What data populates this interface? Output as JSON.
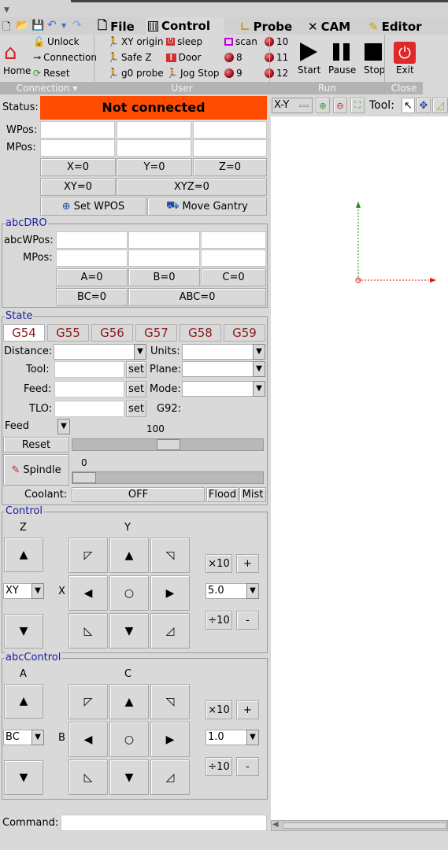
{
  "tabs": [
    {
      "label": "File",
      "icon": "file-icon"
    },
    {
      "label": "Control",
      "icon": "control-icon",
      "active": true
    },
    {
      "label": "Probe",
      "icon": "probe-icon"
    },
    {
      "label": "CAM",
      "icon": "cam-icon"
    },
    {
      "label": "Editor",
      "icon": "editor-icon"
    }
  ],
  "ribbon": {
    "connection": {
      "home": "Home",
      "unlock": "Unlock",
      "connection": "Connection",
      "reset": "Reset",
      "group": "Connection ▾"
    },
    "user": {
      "xy_origin": "XY origin",
      "safe_z": "Safe Z",
      "g0_probe": "g0 probe",
      "sleep": "sleep",
      "door": "Door",
      "jog_stop": "Jog Stop",
      "scan": "scan",
      "b8": "8",
      "b9": "9",
      "b10": "10",
      "b11": "11",
      "b12": "12",
      "group": "User"
    },
    "run": {
      "start": "Start",
      "pause": "Pause",
      "stop": "Stop",
      "group": "Run"
    },
    "close": {
      "exit": "Exit",
      "group": "Close"
    }
  },
  "status": {
    "label": "Status:",
    "value": "Not connected",
    "color": "#ff4c00"
  },
  "dro": {
    "wpos": "WPos:",
    "mpos": "MPos:",
    "x0": "X=0",
    "y0": "Y=0",
    "z0": "Z=0",
    "xy0": "XY=0",
    "xyz0": "XYZ=0",
    "set_wpos": "Set WPOS",
    "move_gantry": "Move Gantry"
  },
  "abcdro": {
    "title": "abcDRO",
    "wpos": "abcWPos:",
    "mpos": "MPos:",
    "a0": "A=0",
    "b0": "B=0",
    "c0": "C=0",
    "bc0": "BC=0",
    "abc0": "ABC=0"
  },
  "state": {
    "title": "State",
    "gcodes": [
      "G54",
      "G55",
      "G56",
      "G57",
      "G58",
      "G59"
    ],
    "distance": "Distance:",
    "units": "Units:",
    "tool": "Tool:",
    "plane": "Plane:",
    "feed": "Feed:",
    "mode": "Mode:",
    "tlo": "TLO:",
    "g92": "G92:",
    "set": "set",
    "feed_select": "Feed",
    "feed_value": "100",
    "feed_override_percent": 100,
    "reset": "Reset",
    "spindle": "Spindle",
    "spindle_value": "0",
    "coolant": "Coolant:",
    "coolant_off": "OFF",
    "flood": "Flood",
    "mist": "Mist"
  },
  "control": {
    "title": "Control",
    "axis_left": "Z",
    "axis_top": "Y",
    "axis_mid": "X",
    "plane": "XY",
    "step": "5.0",
    "x10": "×10",
    "plus": "+",
    "div10": "÷10",
    "minus": "-"
  },
  "abccontrol": {
    "title": "abcControl",
    "axis_left": "A",
    "axis_top": "C",
    "axis_mid": "B",
    "plane": "BC",
    "step": "1.0",
    "x10": "×10",
    "plus": "+",
    "div10": "÷10",
    "minus": "-"
  },
  "command": {
    "label": "Command:",
    "value": ""
  },
  "canvas": {
    "view": "X-Y",
    "tool_label": "Tool:"
  }
}
